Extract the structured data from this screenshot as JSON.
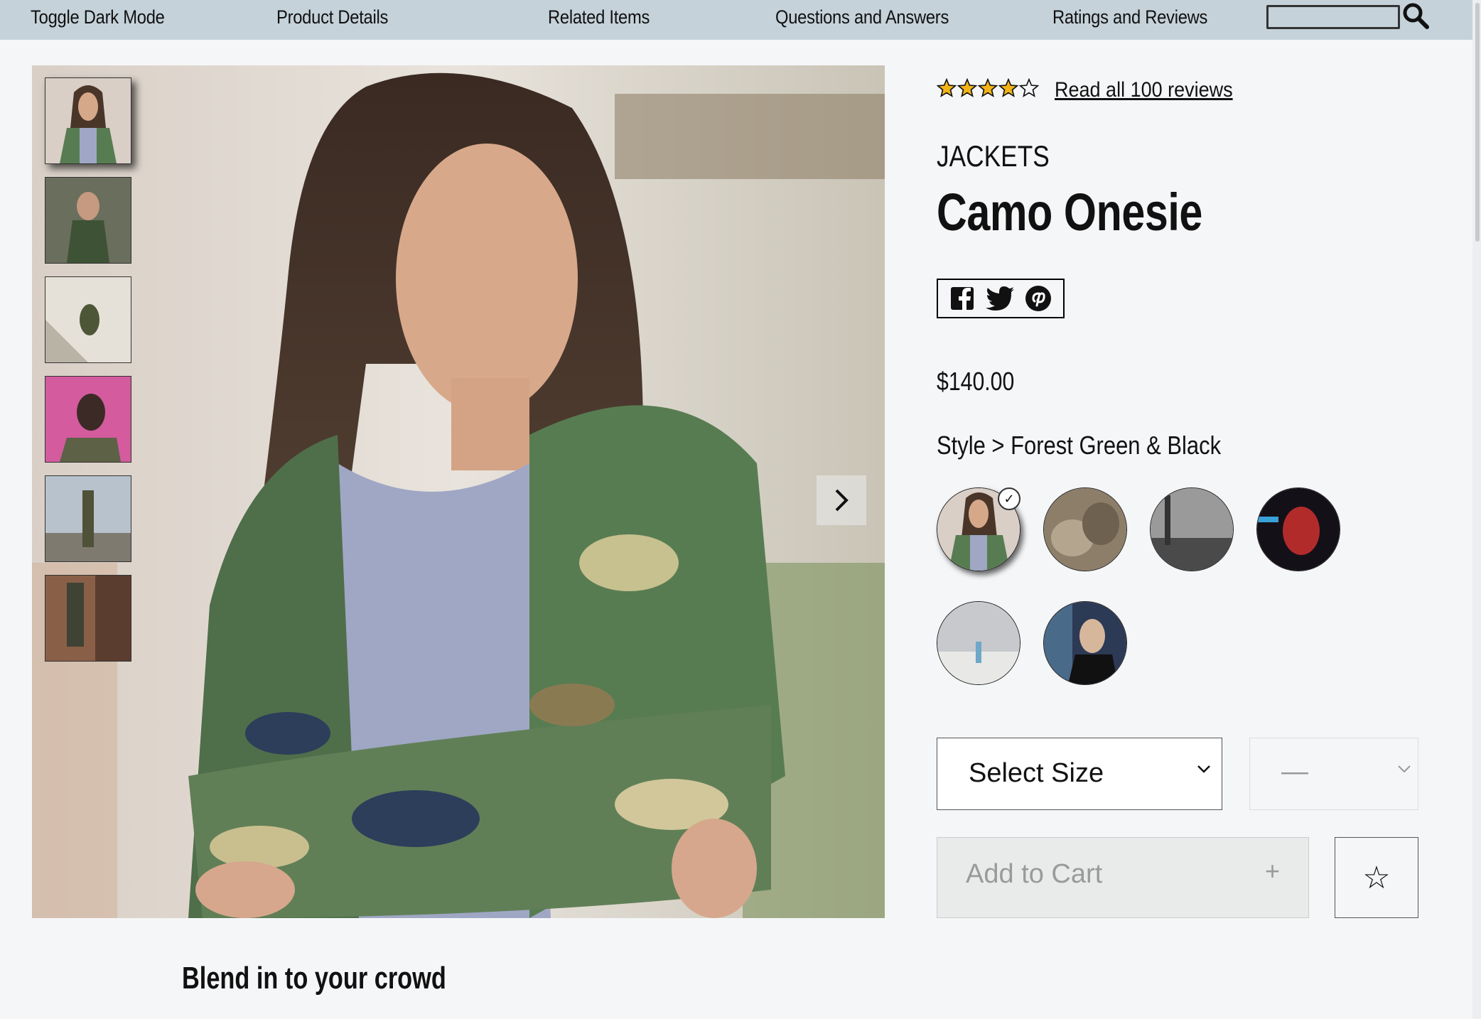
{
  "nav": {
    "items": [
      "Toggle Dark Mode",
      "Product Details",
      "Related Items",
      "Questions and Answers",
      "Ratings and Reviews"
    ],
    "search_value": ""
  },
  "rating": {
    "stars": 4,
    "max": 5,
    "link_text": "Read all 100 reviews"
  },
  "product": {
    "category": "JACKETS",
    "name": "Camo Onesie",
    "price": "$140.00",
    "style_label": "Style > Forest Green & Black"
  },
  "share": {
    "icons": [
      "facebook-icon",
      "twitter-icon",
      "pinterest-icon"
    ]
  },
  "gallery": {
    "thumb_count": 6,
    "selected_index": 0
  },
  "styles": {
    "count": 6,
    "selected_index": 0
  },
  "size_select": {
    "selected": "Select Size"
  },
  "qty_select": {
    "selected": "—"
  },
  "cart": {
    "add_label": "Add to Cart",
    "plus": "+",
    "favorite": "☆"
  },
  "slogan": "Blend in to your crowd",
  "colors": {
    "nav_bg": "#c5d2da",
    "page_bg": "#f5f6f8",
    "star_fill": "#f3b416"
  }
}
